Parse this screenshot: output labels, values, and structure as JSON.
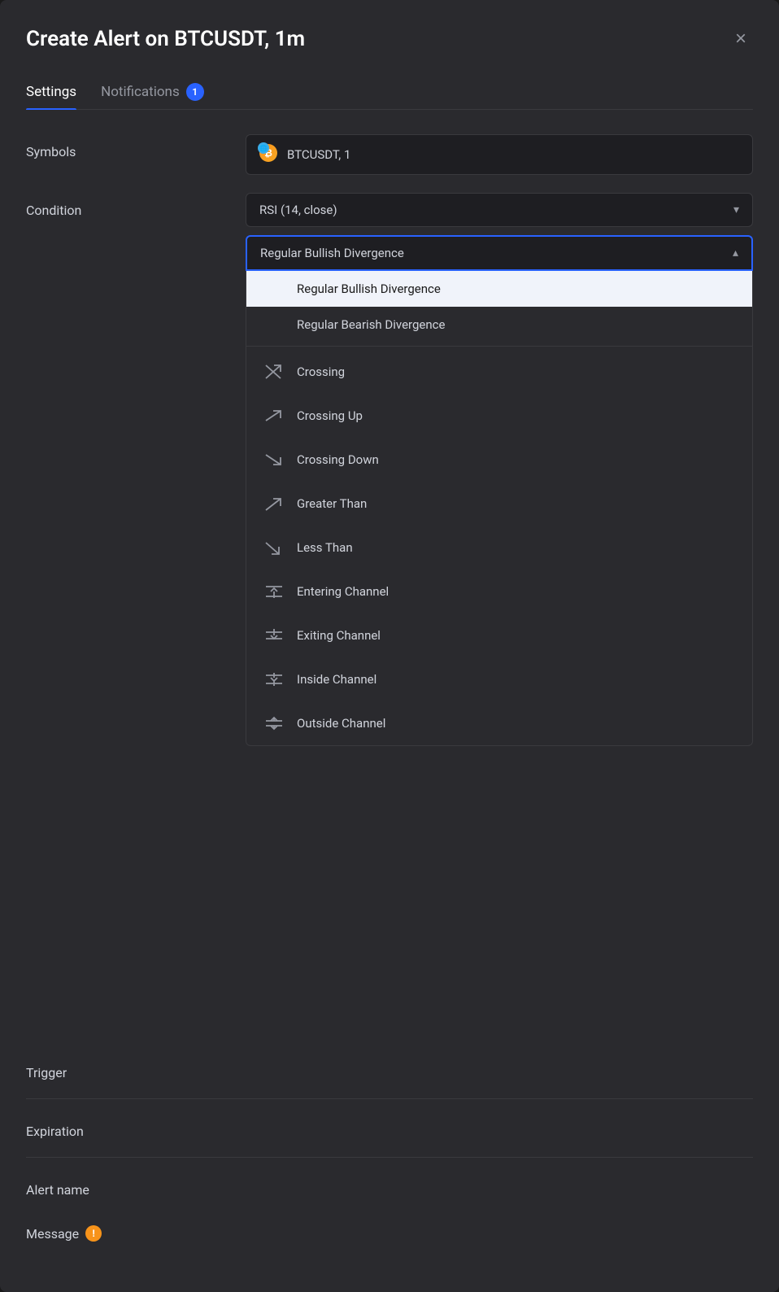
{
  "modal": {
    "title": "Create Alert on BTCUSDT, 1m",
    "close_label": "×"
  },
  "tabs": [
    {
      "label": "Settings",
      "active": true,
      "badge": null
    },
    {
      "label": "Notifications",
      "active": false,
      "badge": "1"
    }
  ],
  "form": {
    "symbols_label": "Symbols",
    "symbols_value": "BTCUSDT, 1",
    "condition_label": "Condition",
    "condition_value": "RSI (14, close)",
    "condition_dropdown_label": "Regular Bullish Divergence",
    "trigger_label": "Trigger",
    "expiration_label": "Expiration",
    "alert_name_label": "Alert name",
    "message_label": "Message"
  },
  "dropdown": {
    "items": [
      {
        "id": "regular-bullish",
        "label": "Regular Bullish Divergence",
        "icon": null,
        "selected": true,
        "divider_after": false
      },
      {
        "id": "regular-bearish",
        "label": "Regular Bearish Divergence",
        "icon": null,
        "selected": false,
        "divider_after": true
      },
      {
        "id": "crossing",
        "label": "Crossing",
        "icon": "crossing",
        "selected": false,
        "divider_after": false
      },
      {
        "id": "crossing-up",
        "label": "Crossing Up",
        "icon": "crossing-up",
        "selected": false,
        "divider_after": false
      },
      {
        "id": "crossing-down",
        "label": "Crossing Down",
        "icon": "crossing-down",
        "selected": false,
        "divider_after": false
      },
      {
        "id": "greater-than",
        "label": "Greater Than",
        "icon": "greater-than",
        "selected": false,
        "divider_after": false
      },
      {
        "id": "less-than",
        "label": "Less Than",
        "icon": "less-than",
        "selected": false,
        "divider_after": false
      },
      {
        "id": "entering-channel",
        "label": "Entering Channel",
        "icon": "entering-channel",
        "selected": false,
        "divider_after": false
      },
      {
        "id": "exiting-channel",
        "label": "Exiting Channel",
        "icon": "exiting-channel",
        "selected": false,
        "divider_after": false
      },
      {
        "id": "inside-channel",
        "label": "Inside Channel",
        "icon": "inside-channel",
        "selected": false,
        "divider_after": false
      },
      {
        "id": "outside-channel",
        "label": "Outside Channel",
        "icon": "outside-channel",
        "selected": false,
        "divider_after": false
      }
    ]
  },
  "icons": {
    "crossing": "⤢",
    "crossing_up": "↗",
    "crossing_down": "↘",
    "greater_than": "↗",
    "less_than": "↘"
  }
}
